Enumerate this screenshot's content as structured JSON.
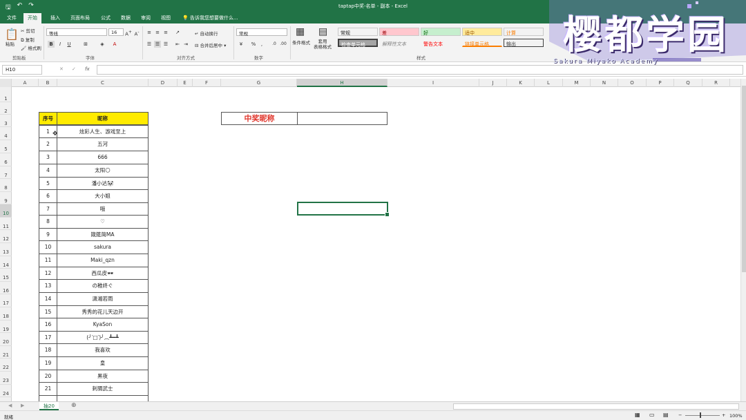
{
  "window": {
    "title": "taptap中奖-名单 - 副本 - Excel"
  },
  "quick_access": {
    "save": "🖫",
    "undo": "↶",
    "redo": "↷"
  },
  "tabs": [
    "文件",
    "开始",
    "插入",
    "页面布局",
    "公式",
    "数据",
    "审阅",
    "视图"
  ],
  "tell_me": "告诉我您想要做什么...",
  "ribbon": {
    "clipboard": {
      "paste": "粘贴",
      "cut": "剪切",
      "copy": "复制",
      "format_painter": "格式刷",
      "label": "剪贴板"
    },
    "font": {
      "name": "等线",
      "size": "16",
      "label": "字体",
      "bold": "B",
      "italic": "I",
      "underline": "U"
    },
    "align": {
      "wrap": "自动换行",
      "merge": "合并后居中",
      "label": "对齐方式"
    },
    "number": {
      "format": "常规",
      "label": "数字",
      "percent": "%",
      "comma": ","
    },
    "styles": {
      "conditional": "条件格式",
      "as_table": "套用\n表格格式",
      "label": "样式",
      "cells": [
        {
          "text": "常规",
          "bg": "#ffffff",
          "fg": "#222222"
        },
        {
          "text": "差",
          "bg": "#ffc7ce",
          "fg": "#9c0006"
        },
        {
          "text": "好",
          "bg": "#c6efce",
          "fg": "#006100"
        },
        {
          "text": "适中",
          "bg": "#ffeb9c",
          "fg": "#9c5700"
        },
        {
          "text": "计算",
          "bg": "#f2f2f2",
          "fg": "#fa7d00"
        },
        {
          "text": "检查单元格",
          "bg": "#a5a5a5",
          "fg": "#ffffff"
        },
        {
          "text": "解释性文本",
          "bg": "#ffffff",
          "fg": "#7f7f7f"
        },
        {
          "text": "警告文本",
          "bg": "#ffffff",
          "fg": "#ff0000"
        },
        {
          "text": "链接单元格",
          "bg": "#ffffff",
          "fg": "#fa7d00"
        },
        {
          "text": "输出",
          "bg": "#f2f2f2",
          "fg": "#3f3f3f"
        }
      ]
    }
  },
  "formula_bar": {
    "name_box": "H10",
    "cancel": "✕",
    "enter": "✓",
    "fx": "fx",
    "value": ""
  },
  "columns": [
    "A",
    "B",
    "C",
    "D",
    "E",
    "F",
    "G",
    "H",
    "I",
    "J",
    "K",
    "L",
    "M",
    "N",
    "O",
    "P",
    "Q",
    "R"
  ],
  "rows": [
    "1",
    "2",
    "3",
    "4",
    "5",
    "6",
    "7",
    "8",
    "9",
    "10",
    "11",
    "12",
    "13",
    "14",
    "15",
    "16",
    "17",
    "18",
    "19",
    "20",
    "21",
    "22",
    "23",
    "24"
  ],
  "table": {
    "headers": {
      "index": "序号",
      "nickname": "昵称"
    },
    "entries": [
      {
        "no": "1",
        "name": "炫彩人生、游戏至上"
      },
      {
        "no": "2",
        "name": "五河"
      },
      {
        "no": "3",
        "name": "666"
      },
      {
        "no": "4",
        "name": "太阳🌕"
      },
      {
        "no": "5",
        "name": "潘小达🐼"
      },
      {
        "no": "6",
        "name": "大小姐"
      },
      {
        "no": "7",
        "name": "哦"
      },
      {
        "no": "8",
        "name": "♡"
      },
      {
        "no": "9",
        "name": "箴筵简MA"
      },
      {
        "no": "10",
        "name": "sakura"
      },
      {
        "no": "11",
        "name": "Maki_qzn"
      },
      {
        "no": "12",
        "name": "西瓜皮🕶"
      },
      {
        "no": "13",
        "name": "の稚终ぐ"
      },
      {
        "no": "14",
        "name": "潇湘若雨"
      },
      {
        "no": "15",
        "name": "秀秀的花儿天边开"
      },
      {
        "no": "16",
        "name": "KyaSon"
      },
      {
        "no": "17",
        "name": "(╯‵□′)╯︵┻━┻"
      },
      {
        "no": "18",
        "name": "我喜欢"
      },
      {
        "no": "19",
        "name": "皇"
      },
      {
        "no": "20",
        "name": "黑夜"
      },
      {
        "no": "21",
        "name": "刺猬武士"
      }
    ]
  },
  "prize": {
    "label": "中奖昵称",
    "value": ""
  },
  "sheet_tabs": [
    "抽20"
  ],
  "status": {
    "ready": "就绪",
    "zoom": "100%"
  },
  "watermark": {
    "title": "樱都学园",
    "subtitle": "Sakura Miyako Academy"
  }
}
